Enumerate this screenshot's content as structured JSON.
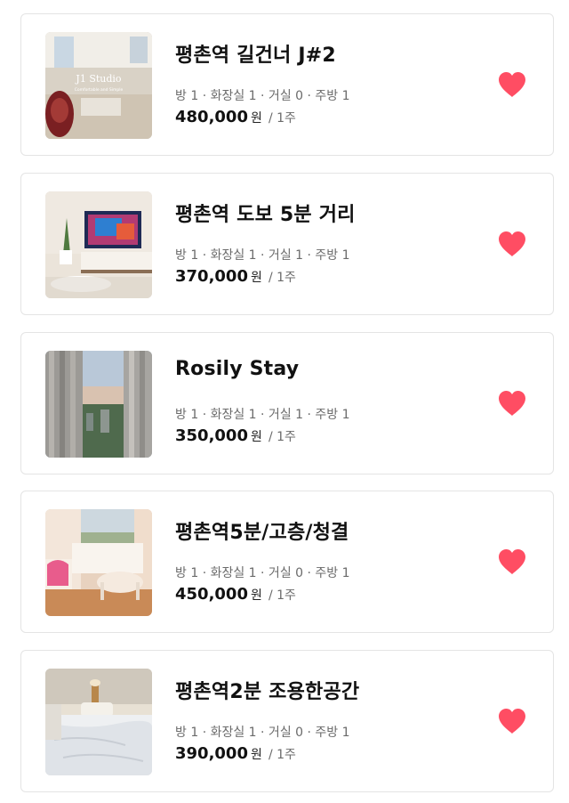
{
  "colors": {
    "heart": "#ff4d63",
    "border": "#e4e4e4",
    "meta_text": "#6b6b6b"
  },
  "listings": [
    {
      "title": "평촌역 길건너 J#2",
      "meta": "방 1 · 화장실 1 · 거실 0 · 주방 1",
      "price": "480,000",
      "currency": "원",
      "period": "/ 1주",
      "favorited": true,
      "thumb_text": "J1 Studio",
      "thumb_subtext": "Comfortable and Simple"
    },
    {
      "title": "평촌역 도보 5분 거리",
      "meta": "방 1 · 화장실 1 · 거실 1 · 주방 1",
      "price": "370,000",
      "currency": "원",
      "period": "/ 1주",
      "favorited": true
    },
    {
      "title": "Rosily Stay",
      "meta": "방 1 · 화장실 1 · 거실 1 · 주방 1",
      "price": "350,000",
      "currency": "원",
      "period": "/ 1주",
      "favorited": true
    },
    {
      "title": "평촌역5분/고층/청결",
      "meta": "방 1 · 화장실 1 · 거실 0 · 주방 1",
      "price": "450,000",
      "currency": "원",
      "period": "/ 1주",
      "favorited": true
    },
    {
      "title": "평촌역2분 조용한공간",
      "meta": "방 1 · 화장실 1 · 거실 0 · 주방 1",
      "price": "390,000",
      "currency": "원",
      "period": "/ 1주",
      "favorited": true
    }
  ]
}
